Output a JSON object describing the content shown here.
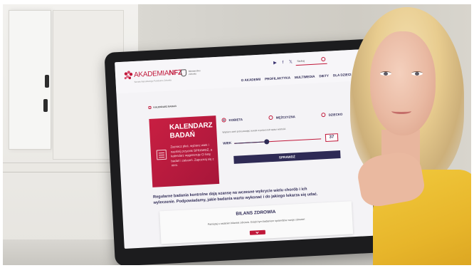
{
  "site": {
    "logo": {
      "brand": "AKADEMIA",
      "brand_suffix": "NFZ",
      "subtitle": "Serwis Narodowego Funduszu Zdrowia"
    },
    "ministry": "Ministerstwo Zdrowia",
    "social_icons": [
      "youtube-icon",
      "facebook-icon",
      "x-icon"
    ],
    "search_placeholder": "Szukaj",
    "nav": [
      "O AKADEMII",
      "PROFILAKTYKA",
      "MULTIMEDIA",
      "DIETY",
      "DLA DZIECI"
    ],
    "breadcrumb": "KALENDARZ BADAŃ"
  },
  "calendar": {
    "title_line1": "KALENDARZ",
    "title_line2": "BADAŃ",
    "description": "Zaznacz płeć, wybierz wiek i naciśnij przycisk SPRAWDŹ, a kalendarz wygeneruje Ci listę badań i zaleceń. Zapoznaj się z nimi."
  },
  "form": {
    "options": [
      {
        "label": "KOBIETA",
        "selected": true
      },
      {
        "label": "MĘŻCZYZNA",
        "selected": false
      },
      {
        "label": "DZIECKO",
        "selected": false
      }
    ],
    "hint": "Wybierz wiek przesuwając suwak w prawo lub wpisz wartość.",
    "age_label": "WIEK",
    "age_value": "37",
    "age_fraction": 0.37,
    "submit_label": "SPRAWDŹ"
  },
  "info_text": "Regularne badania kontrolne dają szansę na wczesne wykrycie wielu chorób i ich wyleczenie. Podpowiadamy, jakie badania warto wykonać i do jakiego lekarza się udać.",
  "bilans": {
    "title": "BILANS ZDROWIA",
    "description": "Pamiętaj o ostatnim bilansie zdrowia. Dzięki tym badaniom sprawdzisz swoje zdrowie!"
  },
  "colors": {
    "brand_red": "#c0183a",
    "navy": "#2e2a55",
    "shirt_yellow": "#e7b52a"
  }
}
